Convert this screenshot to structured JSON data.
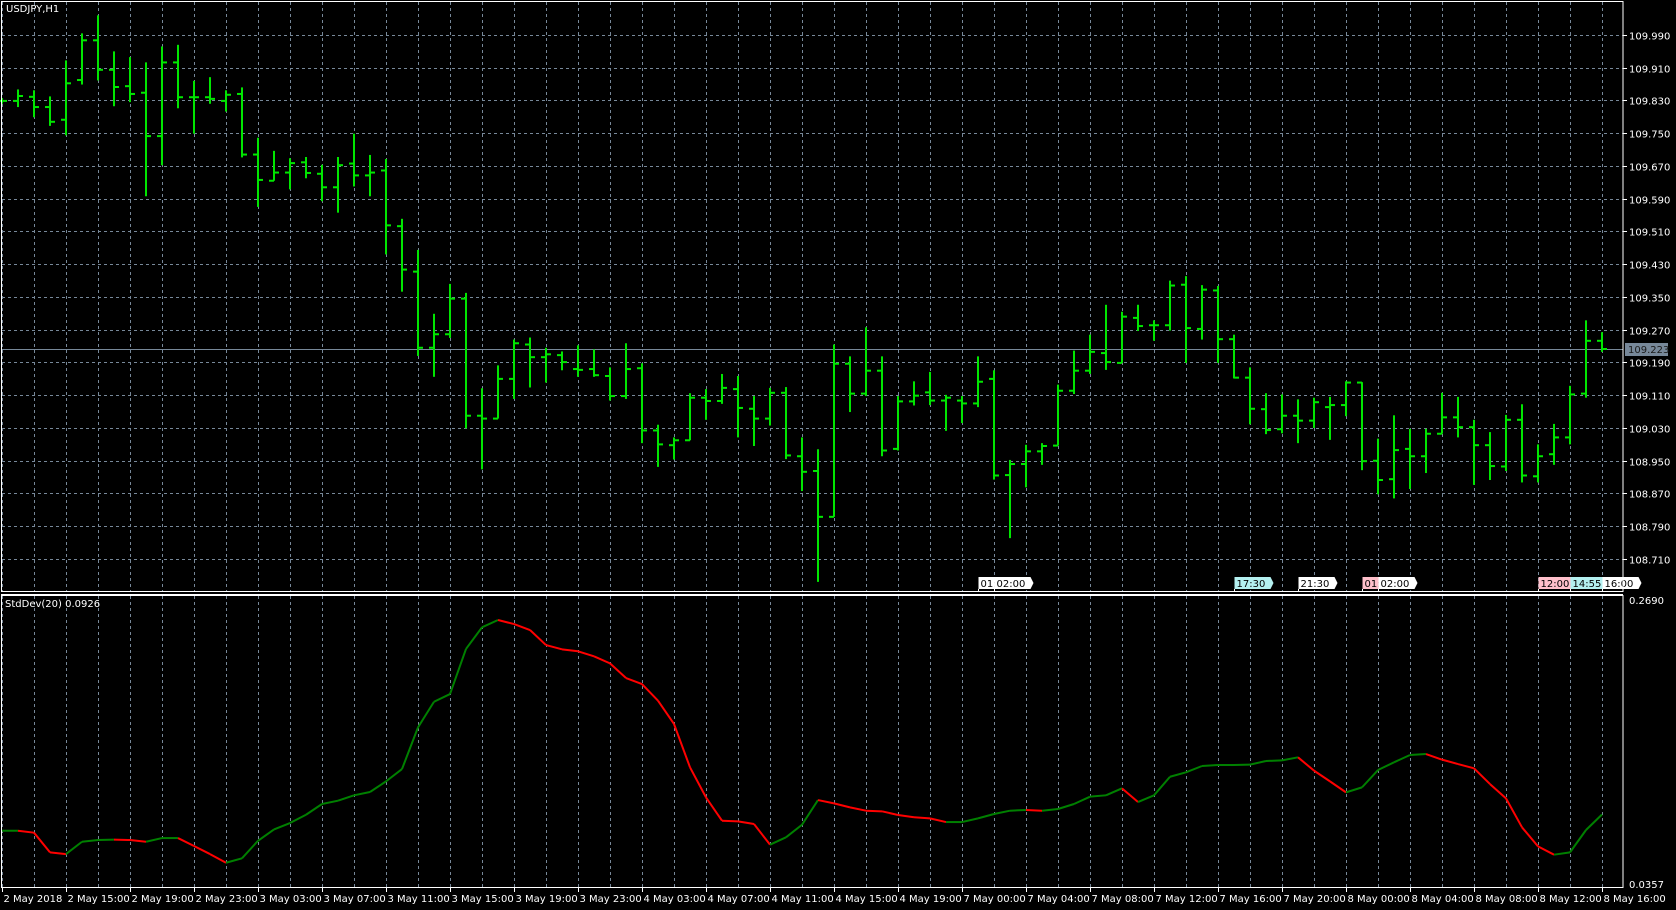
{
  "header": {
    "symbol_label": "USDJPY,H1"
  },
  "indicator": {
    "label": "StdDev(20) 0.0926",
    "max_label": "0.2690",
    "min_label": "0.0357"
  },
  "price_axis": {
    "labels": [
      "109.990",
      "109.910",
      "109.830",
      "109.750",
      "109.670",
      "109.590",
      "109.510",
      "109.430",
      "109.350",
      "109.270",
      "109.190",
      "109.110",
      "109.030",
      "108.950",
      "108.870",
      "108.790",
      "108.710"
    ],
    "current_price": "109.223"
  },
  "time_axis": {
    "labels": [
      "2 May 2018",
      "2 May 15:00",
      "2 May 19:00",
      "2 May 23:00",
      "3 May 03:00",
      "3 May 07:00",
      "3 May 11:00",
      "3 May 15:00",
      "3 May 19:00",
      "3 May 23:00",
      "4 May 03:00",
      "4 May 07:00",
      "4 May 11:00",
      "4 May 15:00",
      "4 May 19:00",
      "7 May 00:00",
      "7 May 04:00",
      "7 May 08:00",
      "7 May 12:00",
      "7 May 16:00",
      "7 May 20:00",
      "8 May 00:00",
      "8 May 04:00",
      "8 May 08:00",
      "8 May 12:00",
      "8 May 16:00"
    ],
    "bars_per_label": 4
  },
  "event_markers": [
    {
      "label": "01:",
      "bar": 61,
      "color": "#ffffff"
    },
    {
      "label": "02:00",
      "bar": 62,
      "color": "#ffffff"
    },
    {
      "label": "17:30",
      "bar": 77,
      "color": "#b4f0f0"
    },
    {
      "label": "21:30",
      "bar": 81,
      "color": "#ffffff"
    },
    {
      "label": "01:",
      "bar": 85,
      "color": "#ffc0cb"
    },
    {
      "label": "02:00",
      "bar": 86,
      "color": "#ffffff"
    },
    {
      "label": "12:00",
      "bar": 96,
      "color": "#ffc0cb"
    },
    {
      "label": "14:55",
      "bar": 98,
      "color": "#b4f0f0"
    },
    {
      "label": "16:00",
      "bar": 100,
      "color": "#ffffff"
    }
  ],
  "colors": {
    "background": "#000000",
    "bars": "#00e600",
    "grid": "#778899",
    "bid_line": "#778899",
    "stddev_up": "#008000",
    "stddev_down": "#ff0000",
    "axis": "#ffffff"
  },
  "chart_data": {
    "type": "ohlc",
    "title": "USDJPY,H1",
    "ylim": [
      108.71,
      109.99
    ],
    "ohlc": [
      [
        109.829,
        109.836,
        109.822,
        109.829
      ],
      [
        109.829,
        109.857,
        109.814,
        109.841
      ],
      [
        109.839,
        109.855,
        109.789,
        109.814
      ],
      [
        109.814,
        109.84,
        109.768,
        109.778
      ],
      [
        109.783,
        109.928,
        109.745,
        109.872
      ],
      [
        109.88,
        109.994,
        109.869,
        109.977
      ],
      [
        109.977,
        110.038,
        109.879,
        109.905
      ],
      [
        109.905,
        109.95,
        109.816,
        109.863
      ],
      [
        109.865,
        109.936,
        109.826,
        109.846
      ],
      [
        109.849,
        109.923,
        109.596,
        109.743
      ],
      [
        109.743,
        109.962,
        109.672,
        109.923
      ],
      [
        109.923,
        109.966,
        109.811,
        109.838
      ],
      [
        109.838,
        109.878,
        109.749,
        109.838
      ],
      [
        109.838,
        109.887,
        109.822,
        109.834
      ],
      [
        109.829,
        109.855,
        109.803,
        109.844
      ],
      [
        109.846,
        109.862,
        109.691,
        109.698
      ],
      [
        109.698,
        109.739,
        109.57,
        109.636
      ],
      [
        109.634,
        109.707,
        109.634,
        109.654
      ],
      [
        109.654,
        109.689,
        109.613,
        109.677
      ],
      [
        109.679,
        109.692,
        109.64,
        109.653
      ],
      [
        109.651,
        109.673,
        109.584,
        109.618
      ],
      [
        109.618,
        109.692,
        109.556,
        109.672
      ],
      [
        109.676,
        109.749,
        109.62,
        109.647
      ],
      [
        109.647,
        109.697,
        109.596,
        109.654
      ],
      [
        109.659,
        109.687,
        109.454,
        109.525
      ],
      [
        109.523,
        109.541,
        109.363,
        109.417
      ],
      [
        109.412,
        109.465,
        109.206,
        109.226
      ],
      [
        109.226,
        109.309,
        109.155,
        109.259
      ],
      [
        109.259,
        109.382,
        109.25,
        109.346
      ],
      [
        109.346,
        109.36,
        109.029,
        109.06
      ],
      [
        109.06,
        109.127,
        108.929,
        109.053
      ],
      [
        109.053,
        109.183,
        109.053,
        109.15
      ],
      [
        109.15,
        109.246,
        109.101,
        109.237
      ],
      [
        109.234,
        109.251,
        109.129,
        109.203
      ],
      [
        109.203,
        109.226,
        109.141,
        109.21
      ],
      [
        109.208,
        109.217,
        109.171,
        109.191
      ],
      [
        109.174,
        109.232,
        109.155,
        109.172
      ],
      [
        109.174,
        109.222,
        109.155,
        109.159
      ],
      [
        109.157,
        109.178,
        109.097,
        109.108
      ],
      [
        109.108,
        109.237,
        109.101,
        109.174
      ],
      [
        109.176,
        109.188,
        108.993,
        109.024
      ],
      [
        109.024,
        109.038,
        108.935,
        108.99
      ],
      [
        108.988,
        109.007,
        108.953,
        109.0
      ],
      [
        109.0,
        109.115,
        109.0,
        109.104
      ],
      [
        109.104,
        109.125,
        109.05,
        109.096
      ],
      [
        109.096,
        109.162,
        109.089,
        109.128
      ],
      [
        109.125,
        109.157,
        109.007,
        109.079
      ],
      [
        109.077,
        109.108,
        108.986,
        109.053
      ],
      [
        109.053,
        109.128,
        109.036,
        109.116
      ],
      [
        109.116,
        109.13,
        108.954,
        108.963
      ],
      [
        108.961,
        109.007,
        108.876,
        108.923
      ],
      [
        108.925,
        108.978,
        108.654,
        108.813
      ],
      [
        108.813,
        109.234,
        108.813,
        109.187
      ],
      [
        109.187,
        109.205,
        109.069,
        109.114
      ],
      [
        109.114,
        109.276,
        109.108,
        109.17
      ],
      [
        109.17,
        109.205,
        108.961,
        108.975
      ],
      [
        108.979,
        109.108,
        108.975,
        109.095
      ],
      [
        109.095,
        109.144,
        109.085,
        109.109
      ],
      [
        109.117,
        109.167,
        109.086,
        109.097
      ],
      [
        109.097,
        109.111,
        109.023,
        109.104
      ],
      [
        109.097,
        109.108,
        109.042,
        109.09
      ],
      [
        109.09,
        109.205,
        109.081,
        109.143
      ],
      [
        109.15,
        109.171,
        108.904,
        108.914
      ],
      [
        108.915,
        108.952,
        108.761,
        108.942
      ],
      [
        108.942,
        108.989,
        108.885,
        108.973
      ],
      [
        108.973,
        108.993,
        108.94,
        108.986
      ],
      [
        108.987,
        109.136,
        108.987,
        109.121
      ],
      [
        109.121,
        109.219,
        109.113,
        109.17
      ],
      [
        109.17,
        109.258,
        109.162,
        109.216
      ],
      [
        109.213,
        109.331,
        109.172,
        109.191
      ],
      [
        109.189,
        109.314,
        109.189,
        109.302
      ],
      [
        109.299,
        109.331,
        109.267,
        109.279
      ],
      [
        109.281,
        109.293,
        109.243,
        109.281
      ],
      [
        109.281,
        109.39,
        109.268,
        109.378
      ],
      [
        109.38,
        109.401,
        109.189,
        109.274
      ],
      [
        109.272,
        109.379,
        109.246,
        109.368
      ],
      [
        109.366,
        109.377,
        109.189,
        109.247
      ],
      [
        109.247,
        109.258,
        109.151,
        109.153
      ],
      [
        109.153,
        109.178,
        109.039,
        109.077
      ],
      [
        109.076,
        109.115,
        109.015,
        109.025
      ],
      [
        109.027,
        109.112,
        109.017,
        109.06
      ],
      [
        109.06,
        109.1,
        108.993,
        109.048
      ],
      [
        109.048,
        109.104,
        109.03,
        109.093
      ],
      [
        109.081,
        109.106,
        109.001,
        109.086
      ],
      [
        109.086,
        109.144,
        109.059,
        109.141
      ],
      [
        109.141,
        109.142,
        108.927,
        108.949
      ],
      [
        108.95,
        109.004,
        108.868,
        108.903
      ],
      [
        108.905,
        109.061,
        108.858,
        108.976
      ],
      [
        108.979,
        109.028,
        108.881,
        108.961
      ],
      [
        108.961,
        109.028,
        108.92,
        109.016
      ],
      [
        109.016,
        109.116,
        109.016,
        109.056
      ],
      [
        109.056,
        109.106,
        109.007,
        109.032
      ],
      [
        109.032,
        109.05,
        108.891,
        108.988
      ],
      [
        108.988,
        109.02,
        108.903,
        108.937
      ],
      [
        108.936,
        109.062,
        108.925,
        109.05
      ],
      [
        109.05,
        109.088,
        108.897,
        108.914
      ],
      [
        108.912,
        108.99,
        108.897,
        108.961
      ],
      [
        108.966,
        109.04,
        108.94,
        109.007
      ],
      [
        109.007,
        109.133,
        108.99,
        109.112
      ],
      [
        109.114,
        109.293,
        109.104,
        109.243
      ],
      [
        109.243,
        109.264,
        109.216,
        109.223
      ]
    ],
    "last_price": 109.223,
    "stddev": {
      "name": "StdDev(20)",
      "ylim": [
        0.0357,
        0.269
      ],
      "values": [
        0.0793,
        0.0793,
        0.0777,
        0.0616,
        0.0602,
        0.0703,
        0.0717,
        0.072,
        0.0717,
        0.0703,
        0.0733,
        0.0733,
        0.0668,
        0.0602,
        0.0531,
        0.0567,
        0.0711,
        0.0804,
        0.0856,
        0.0924,
        0.1012,
        0.1039,
        0.1083,
        0.111,
        0.1197,
        0.1298,
        0.1639,
        0.1849,
        0.1912,
        0.2281,
        0.2458,
        0.2518,
        0.2485,
        0.2436,
        0.2313,
        0.2278,
        0.2262,
        0.2221,
        0.2163,
        0.2043,
        0.1994,
        0.1858,
        0.1667,
        0.1312,
        0.1066,
        0.0875,
        0.087,
        0.0848,
        0.0679,
        0.0739,
        0.0842,
        0.1044,
        0.1017,
        0.0984,
        0.0957,
        0.0952,
        0.0922,
        0.0903,
        0.0894,
        0.0864,
        0.0864,
        0.0894,
        0.093,
        0.0957,
        0.0963,
        0.0957,
        0.0971,
        0.1012,
        0.1072,
        0.1083,
        0.114,
        0.1028,
        0.1083,
        0.1235,
        0.1271,
        0.1323,
        0.1331,
        0.1331,
        0.1334,
        0.1364,
        0.1369,
        0.1394,
        0.1285,
        0.1197,
        0.1107,
        0.1148,
        0.129,
        0.1353,
        0.1413,
        0.1421,
        0.1375,
        0.1339,
        0.1304,
        0.1175,
        0.1058,
        0.0821,
        0.0665,
        0.0597,
        0.0616,
        0.0799,
        0.0926
      ]
    }
  }
}
